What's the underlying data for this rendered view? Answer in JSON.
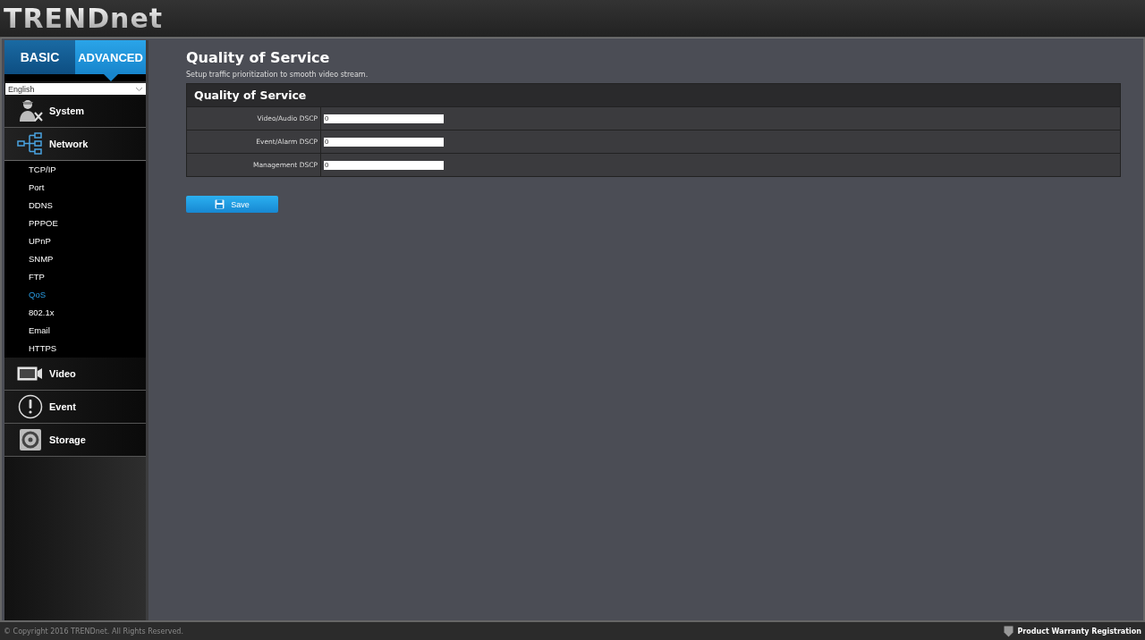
{
  "logo": "TRENDnet",
  "mode_tabs": [
    {
      "label": "BASIC",
      "selected": false
    },
    {
      "label": "ADVANCED",
      "selected": true
    }
  ],
  "language": {
    "value": "English"
  },
  "menu": [
    {
      "label": "System",
      "kind": "system",
      "expanded": false
    },
    {
      "label": "Network",
      "kind": "network",
      "expanded": true,
      "children": [
        {
          "label": "TCP/IP",
          "selected": false
        },
        {
          "label": "Port",
          "selected": false
        },
        {
          "label": "DDNS",
          "selected": false
        },
        {
          "label": "PPPOE",
          "selected": false
        },
        {
          "label": "UPnP",
          "selected": false
        },
        {
          "label": "SNMP",
          "selected": false
        },
        {
          "label": "FTP",
          "selected": false
        },
        {
          "label": "QoS",
          "selected": true
        },
        {
          "label": "802.1x",
          "selected": false
        },
        {
          "label": "Email",
          "selected": false
        },
        {
          "label": "HTTPS",
          "selected": false
        }
      ]
    },
    {
      "label": "Video",
      "kind": "video",
      "expanded": false
    },
    {
      "label": "Event",
      "kind": "event",
      "expanded": false
    },
    {
      "label": "Storage",
      "kind": "storage",
      "expanded": false
    }
  ],
  "page": {
    "title": "Quality of Service",
    "subtitle": "Setup traffic prioritization to smooth video stream."
  },
  "panel": {
    "title": "Quality of Service",
    "fields": [
      {
        "label": "Video/Audio DSCP",
        "value": "0"
      },
      {
        "label": "Event/Alarm DSCP",
        "value": "0"
      },
      {
        "label": "Management DSCP",
        "value": "0"
      }
    ]
  },
  "save_button": "Save",
  "footer": {
    "copyright": "© Copyright 2016 TRENDnet. All Rights Reserved.",
    "warranty_link": "Product Warranty Registration"
  }
}
